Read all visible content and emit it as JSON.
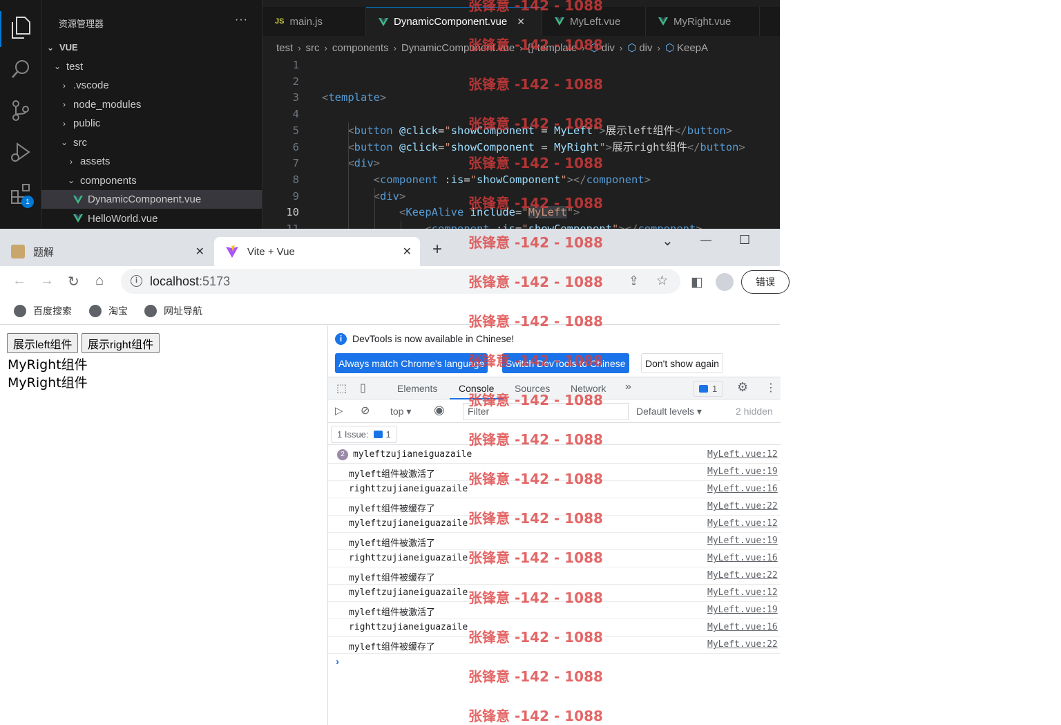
{
  "vscode": {
    "explorer_title": "资源管理器",
    "explorer_more": "···",
    "activity_badge": "1",
    "tree": [
      {
        "label": "VUE",
        "depth": 0,
        "chev": "down",
        "bold": true
      },
      {
        "label": "test",
        "depth": 1,
        "chev": "down"
      },
      {
        "label": ".vscode",
        "depth": 2,
        "chev": "right"
      },
      {
        "label": "node_modules",
        "depth": 2,
        "chev": "right"
      },
      {
        "label": "public",
        "depth": 2,
        "chev": "right"
      },
      {
        "label": "src",
        "depth": 2,
        "chev": "down"
      },
      {
        "label": "assets",
        "depth": 3,
        "chev": "right"
      },
      {
        "label": "components",
        "depth": 3,
        "chev": "down"
      },
      {
        "label": "DynamicComponent.vue",
        "depth": 4,
        "vue": true,
        "selected": true
      },
      {
        "label": "HelloWorld.vue",
        "depth": 4,
        "vue": true
      }
    ],
    "tabs": [
      {
        "label": "main.js",
        "icon": "JS"
      },
      {
        "label": "DynamicComponent.vue",
        "icon": "vue",
        "active": true,
        "close": "✕"
      },
      {
        "label": "MyLeft.vue",
        "icon": "vue"
      },
      {
        "label": "MyRight.vue",
        "icon": "vue"
      }
    ],
    "breadcrumb": [
      "test",
      "src",
      "components",
      "DynamicComponent.vue",
      "{} template",
      "div",
      "div",
      "KeepA"
    ],
    "code_lines": [
      {
        "n": "1",
        "html": ""
      },
      {
        "n": "2",
        "html": ""
      },
      {
        "n": "3",
        "html": "<span class='tk-punct'>&lt;</span><span class='tk-tag'>template</span><span class='tk-punct'>&gt;</span>"
      },
      {
        "n": "4",
        "html": ""
      },
      {
        "n": "5",
        "html": "    <span class='tk-punct'>&lt;</span><span class='tk-tag'>button</span> <span class='tk-attr'>@click</span><span class='tk-txt'>=</span><span class='tk-str'>\"</span><span class='tk-attr'>showComponent</span> <span class='tk-txt'>=</span> <span class='tk-attr'>MyLeft</span><span class='tk-str'>\"</span><span class='tk-punct'>&gt;</span><span class='tk-txt'>展示left组件</span><span class='tk-punct'>&lt;/</span><span class='tk-tag'>button</span><span class='tk-punct'>&gt;</span>"
      },
      {
        "n": "6",
        "html": "    <span class='tk-punct'>&lt;</span><span class='tk-tag'>button</span> <span class='tk-attr'>@click</span><span class='tk-txt'>=</span><span class='tk-str'>\"</span><span class='tk-attr'>showComponent</span> <span class='tk-txt'>=</span> <span class='tk-attr'>MyRight</span><span class='tk-str'>\"</span><span class='tk-punct'>&gt;</span><span class='tk-txt'>展示right组件</span><span class='tk-punct'>&lt;/</span><span class='tk-tag'>button</span><span class='tk-punct'>&gt;</span>"
      },
      {
        "n": "7",
        "html": "    <span class='tk-punct'>&lt;</span><span class='tk-tag'>div</span><span class='tk-punct'>&gt;</span>"
      },
      {
        "n": "8",
        "html": "        <span class='tk-punct'>&lt;</span><span class='tk-tag'>component</span> <span class='tk-attr'>:is</span><span class='tk-txt'>=</span><span class='tk-str'>\"</span><span class='tk-attr'>showComponent</span><span class='tk-str'>\"</span><span class='tk-punct'>&gt;&lt;/</span><span class='tk-tag'>component</span><span class='tk-punct'>&gt;</span>"
      },
      {
        "n": "9",
        "html": "        <span class='tk-punct'>&lt;</span><span class='tk-tag'>div</span><span class='tk-punct'>&gt;</span>"
      },
      {
        "n": "10",
        "html": "            <span class='tk-punct'>&lt;</span><span class='tk-tag'>KeepAlive</span> <span class='tk-attr'>include</span><span class='tk-txt'>=</span><span class='tk-str'>\"<span class='tk-hl'>MyLeft</span>\"</span><span class='tk-punct'>&gt;</span>",
        "current": true
      },
      {
        "n": "11",
        "html": "                <span class='tk-punct'>&lt;</span><span class='tk-tag'>component</span> <span class='tk-attr'>:is</span><span class='tk-txt'>=</span><span class='tk-str'>\"</span><span class='tk-attr'>showComponent</span><span class='tk-str'>\"</span><span class='tk-punct'>&gt;&lt;/</span><span class='tk-tag'>component</span><span class='tk-punct'>&gt;</span>"
      }
    ]
  },
  "browser": {
    "tabs": [
      {
        "title": "题解",
        "close": "✕"
      },
      {
        "title": "Vite + Vue",
        "close": "✕",
        "active": true
      }
    ],
    "new_tab": "+",
    "window_controls": {
      "down": "⌄",
      "minimize": "—",
      "maximize": "☐"
    },
    "url_host": "localhost",
    "url_port": ":5173",
    "error_button": "错误",
    "bookmarks": [
      "百度搜索",
      "淘宝",
      "网址导航"
    ]
  },
  "page": {
    "buttons": [
      "展示left组件",
      "展示right组件"
    ],
    "lines": [
      "MyRight组件",
      "MyRight组件"
    ]
  },
  "devtools": {
    "banner": "DevTools is now available in Chinese!",
    "banner_buttons": [
      "Always match Chrome's language",
      "Switch DevTools to Chinese",
      "Don't show again"
    ],
    "tabs": [
      "Elements",
      "Console",
      "Sources",
      "Network"
    ],
    "more_tabs": "»",
    "issues_count": "1",
    "context": "top",
    "filter_placeholder": "Filter",
    "levels": "Default levels",
    "hidden": "2 hidden",
    "issue_chip_label": "1 Issue:",
    "issue_chip_count": "1",
    "logs": [
      {
        "msg": "myleftzujianeiguazaile",
        "loc": "MyLeft.vue:12",
        "count": "2"
      },
      {
        "msg": "myleft组件被激活了",
        "loc": "MyLeft.vue:19"
      },
      {
        "msg": "righttzujianeiguazaile",
        "loc": "MyLeft.vue:16"
      },
      {
        "msg": "myleft组件被缓存了",
        "loc": "MyLeft.vue:22"
      },
      {
        "msg": "myleftzujianeiguazaile",
        "loc": "MyLeft.vue:12"
      },
      {
        "msg": "myleft组件被激活了",
        "loc": "MyLeft.vue:19"
      },
      {
        "msg": "righttzujianeiguazaile",
        "loc": "MyLeft.vue:16"
      },
      {
        "msg": "myleft组件被缓存了",
        "loc": "MyLeft.vue:22"
      },
      {
        "msg": "myleftzujianeiguazaile",
        "loc": "MyLeft.vue:12"
      },
      {
        "msg": "myleft组件被激活了",
        "loc": "MyLeft.vue:19"
      },
      {
        "msg": "righttzujianeiguazaile",
        "loc": "MyLeft.vue:16"
      },
      {
        "msg": "myleft组件被缓存了",
        "loc": "MyLeft.vue:22"
      }
    ],
    "prompt": "›"
  },
  "watermark": "张锋意 -142 - 1088"
}
